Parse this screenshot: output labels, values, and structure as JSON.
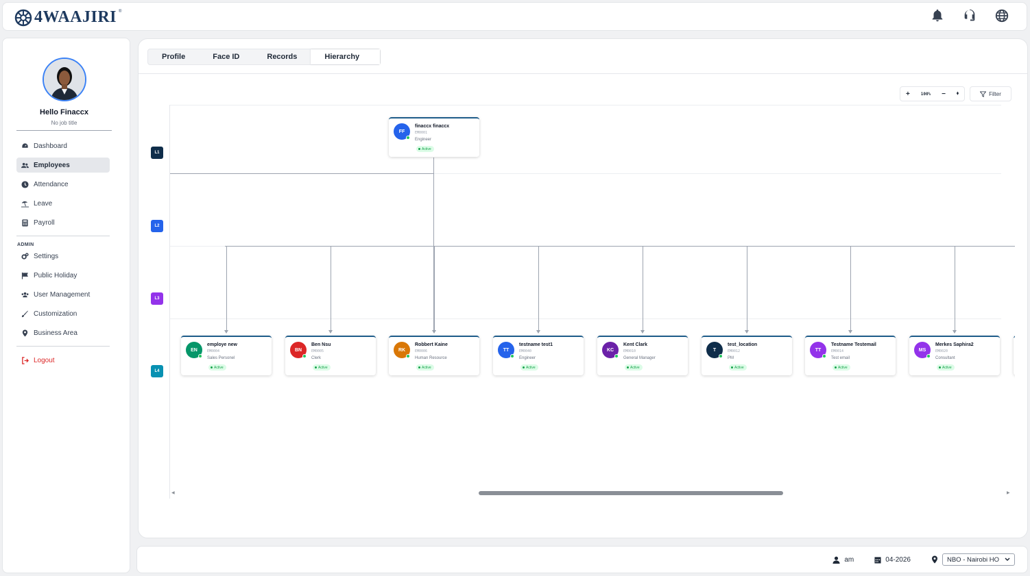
{
  "app": {
    "brand": "4WAAJIRI",
    "brand_tm": "®"
  },
  "topbar": {
    "icons": [
      "bell-icon",
      "headset-icon",
      "globe-icon"
    ]
  },
  "profile": {
    "greeting": "Hello Finaccx",
    "job_title": "No job title"
  },
  "sidebar": {
    "items": [
      {
        "label": "Dashboard",
        "icon": "dashboard-icon"
      },
      {
        "label": "Employees",
        "icon": "users-icon",
        "active": true
      },
      {
        "label": "Attendance",
        "icon": "clock-icon"
      },
      {
        "label": "Leave",
        "icon": "beach-icon"
      },
      {
        "label": "Payroll",
        "icon": "calculator-icon"
      }
    ],
    "admin_heading": "ADMIN",
    "admin_items": [
      {
        "label": "Settings",
        "icon": "gears-icon"
      },
      {
        "label": "Public Holiday",
        "icon": "flag-icon"
      },
      {
        "label": "User Management",
        "icon": "users-cog-icon"
      },
      {
        "label": "Customization",
        "icon": "brush-icon"
      },
      {
        "label": "Business Area",
        "icon": "location-pin-icon"
      }
    ],
    "logout": "Logout"
  },
  "tabs": [
    {
      "label": "Profile"
    },
    {
      "label": "Face ID"
    },
    {
      "label": "Records"
    },
    {
      "label": "Hierarchy",
      "active": true
    }
  ],
  "toolbar": {
    "zoom_in": "+",
    "zoom_value": "100%",
    "zoom_out": "−",
    "reset": "⬧",
    "filter_label": "Filter"
  },
  "levels": [
    {
      "label": "L1",
      "color": "#0f2d4a"
    },
    {
      "label": "L2",
      "color": "#2563eb"
    },
    {
      "label": "L3",
      "color": "#9333ea"
    },
    {
      "label": "L4",
      "color": "#0891b2"
    }
  ],
  "root": {
    "initials": "FF",
    "name": "finaccx finaccx",
    "id": "EM0001",
    "role": "Engineer",
    "status": "Active",
    "color": "#2563eb"
  },
  "employees": [
    {
      "initials": "EN",
      "name": "employe new",
      "id": "EM0004",
      "role": "Sales Personel",
      "status": "Active",
      "color": "#059669"
    },
    {
      "initials": "BN",
      "name": "Ben Nsu",
      "id": "EM0005",
      "role": "Clerk",
      "status": "Active",
      "color": "#dc2626"
    },
    {
      "initials": "RK",
      "name": "Robbert Kaine",
      "id": "EM0006",
      "role": "Human Resource",
      "status": "Active",
      "color": "#d97706"
    },
    {
      "initials": "TT",
      "name": "testname test1",
      "id": "EM0040",
      "role": "Engineer",
      "status": "Active",
      "color": "#2563eb"
    },
    {
      "initials": "KC",
      "name": "Kent Clark",
      "id": "EM0010",
      "role": "General Manager",
      "status": "Active",
      "color": "#6b21a8"
    },
    {
      "initials": "T",
      "name": "test_location",
      "id": "EM0012",
      "role": "PM",
      "status": "Active",
      "color": "#0f2d4a"
    },
    {
      "initials": "TT",
      "name": "Testname Testemail",
      "id": "EM0014",
      "role": "Test email",
      "status": "Active",
      "color": "#9333ea"
    },
    {
      "initials": "MS",
      "name": "Merkes Saphira2",
      "id": "EM0020",
      "role": "Consultant",
      "status": "Active",
      "color": "#9333ea"
    }
  ],
  "footer": {
    "user": "am",
    "period": "04-2026",
    "location": "NBO - Nairobi HO"
  }
}
